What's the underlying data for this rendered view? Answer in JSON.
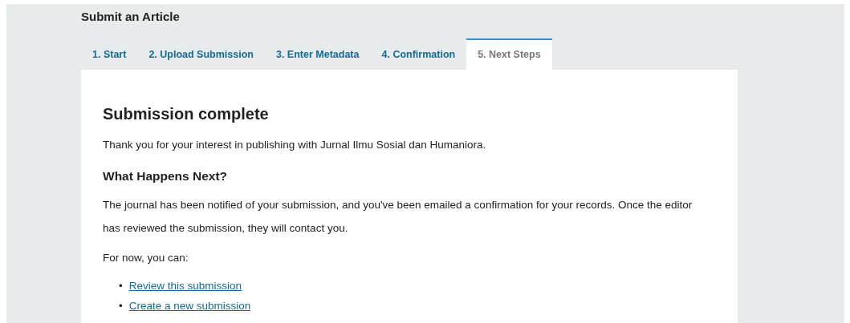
{
  "page_title": "Submit an Article",
  "tabs": [
    {
      "label": "1. Start",
      "selected": false
    },
    {
      "label": "2. Upload Submission",
      "selected": false
    },
    {
      "label": "3. Enter Metadata",
      "selected": false
    },
    {
      "label": "4. Confirmation",
      "selected": false
    },
    {
      "label": "5. Next Steps",
      "selected": true
    }
  ],
  "heading": "Submission complete",
  "intro": "Thank you for your interest in publishing with Jurnal Ilmu Sosial dan Humaniora.",
  "subheading": "What Happens Next?",
  "message": "The journal has been notified of your submission, and you've been emailed a confirmation for your records. Once the editor has reviewed the submission, they will contact you.",
  "options_intro": "For now, you can:",
  "links": [
    {
      "bullet": "•",
      "label": "Review this submission"
    },
    {
      "bullet": "•",
      "label": "Create a new submission"
    }
  ]
}
